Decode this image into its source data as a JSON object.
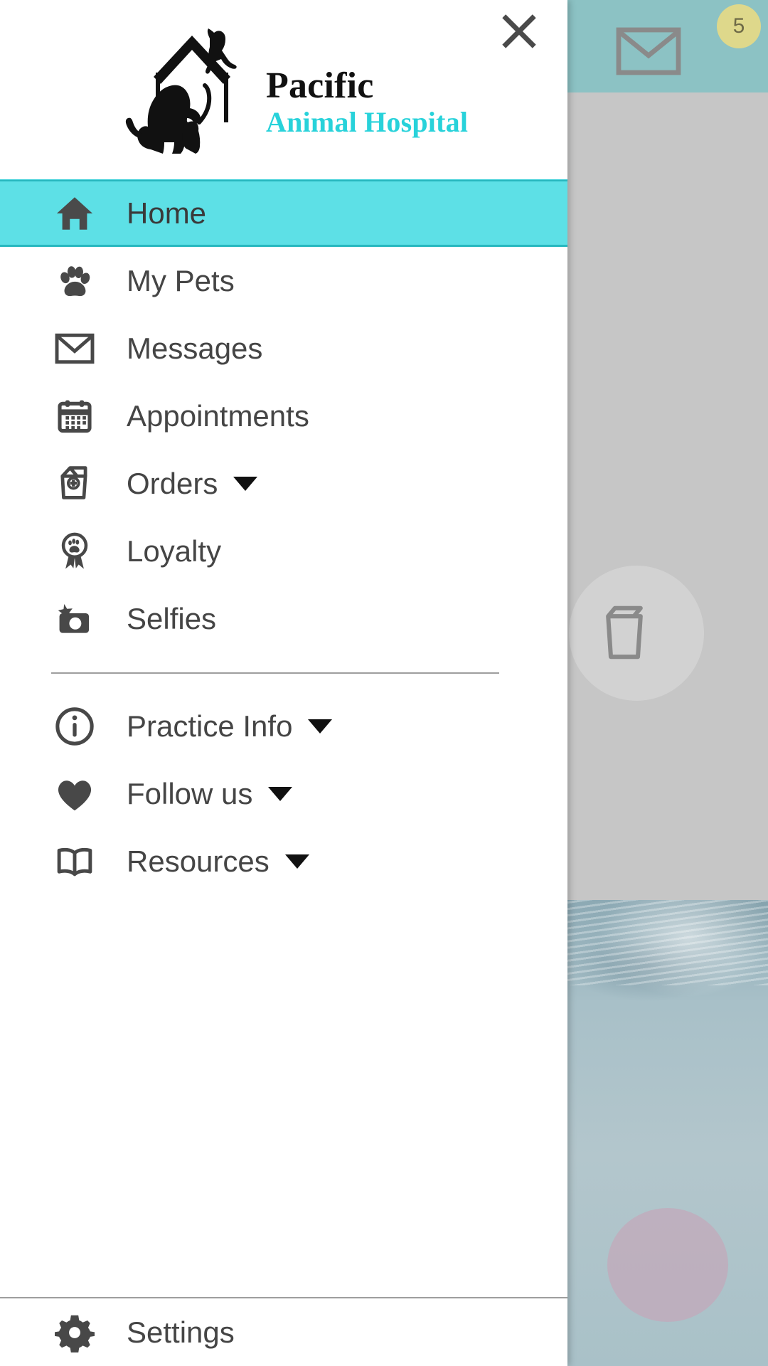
{
  "brand": {
    "name_line1": "Pacific",
    "name_line2": "Animal Hospital",
    "accent_color": "#28d2da",
    "logo_icon": "house-with-dog-cat-logo"
  },
  "header": {
    "close_icon": "close-icon"
  },
  "nav": {
    "primary_items": [
      {
        "label": "Home",
        "icon": "home-icon",
        "active": true,
        "has_caret": false
      },
      {
        "label": "My Pets",
        "icon": "paw-icon",
        "active": false,
        "has_caret": false
      },
      {
        "label": "Messages",
        "icon": "envelope-icon",
        "active": false,
        "has_caret": false
      },
      {
        "label": "Appointments",
        "icon": "calendar-icon",
        "active": false,
        "has_caret": false
      },
      {
        "label": "Orders",
        "icon": "food-bag-icon",
        "active": false,
        "has_caret": true
      },
      {
        "label": "Loyalty",
        "icon": "award-paw-icon",
        "active": false,
        "has_caret": false
      },
      {
        "label": "Selfies",
        "icon": "camera-star-icon",
        "active": false,
        "has_caret": false
      }
    ],
    "secondary_items": [
      {
        "label": "Practice Info",
        "icon": "info-circle-icon",
        "has_caret": true
      },
      {
        "label": "Follow us",
        "icon": "heart-icon",
        "has_caret": true
      },
      {
        "label": "Resources",
        "icon": "book-icon",
        "has_caret": true
      }
    ],
    "footer_items": [
      {
        "label": "Settings",
        "icon": "gear-icon",
        "has_caret": false
      }
    ],
    "active_highlight_color": "#5de0e6"
  },
  "background": {
    "header_color": "#8cc2c4",
    "body_color": "#c6c6c6",
    "message_badge_count": "5",
    "message_icon": "envelope-icon",
    "orders_icon": "food-bag-icon",
    "badge_color": "#ded88b"
  }
}
